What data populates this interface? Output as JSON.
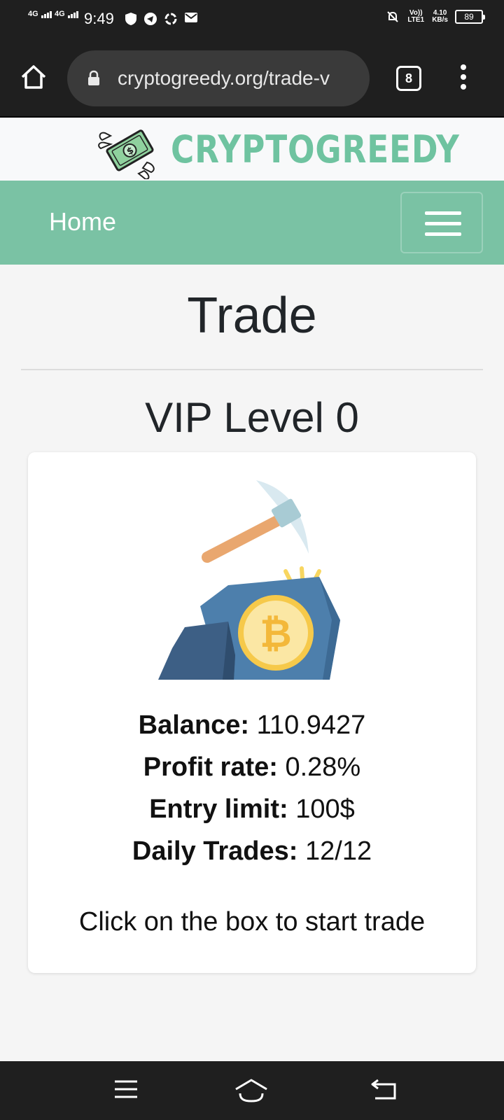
{
  "status_bar": {
    "signal_1": "4G",
    "signal_2": "4G",
    "time": "9:49",
    "volte": "Vo)) LTE1",
    "speed_value": "4.10",
    "speed_unit": "KB/s",
    "battery": "89"
  },
  "browser": {
    "url": "cryptogreedy.org/trade-v",
    "tab_count": "8"
  },
  "site": {
    "logo_text": "CRYPTOGREEDY",
    "nav_home": "Home",
    "colors": {
      "brand_green": "#7ac2a4",
      "logo_green": "#6fc3a0"
    }
  },
  "page": {
    "title": "Trade",
    "vip_level": "VIP Level 0",
    "stats": {
      "balance_label": "Balance:",
      "balance_value": "110.9427",
      "profit_label": "Profit rate:",
      "profit_value": "0.28%",
      "entry_label": "Entry limit:",
      "entry_value": "100$",
      "trades_label": "Daily Trades:",
      "trades_value": "12/12"
    },
    "cta": "Click on the box to start trade"
  }
}
